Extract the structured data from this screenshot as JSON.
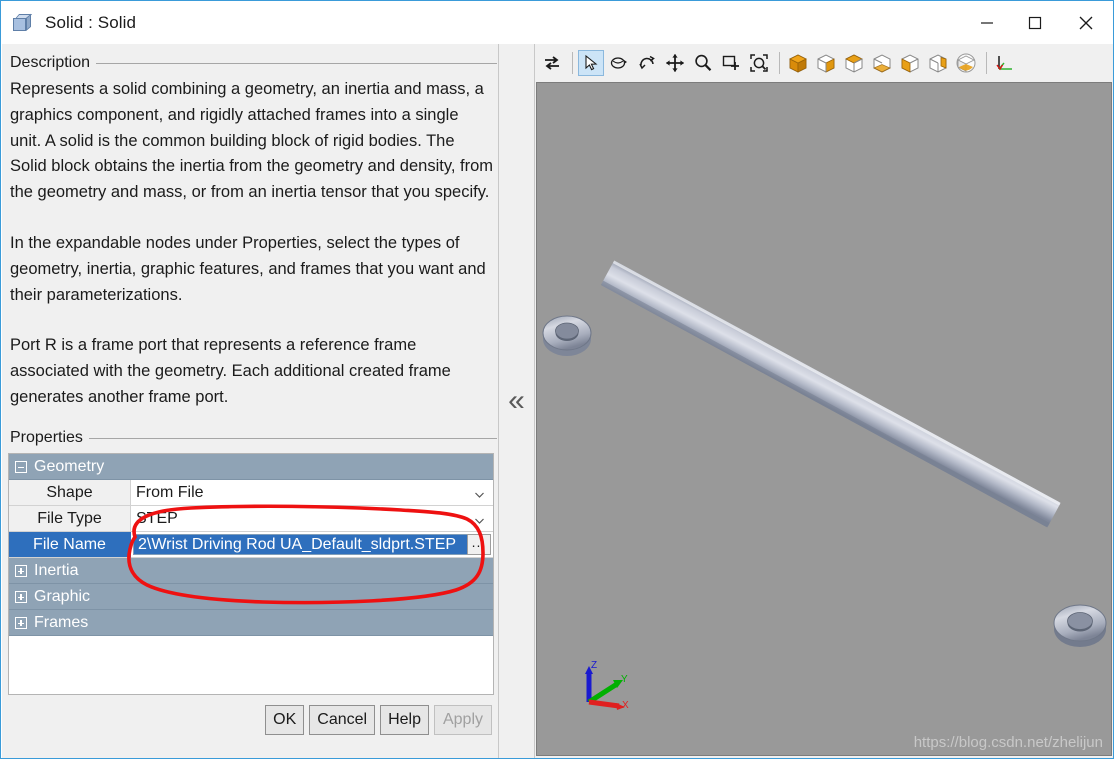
{
  "window": {
    "title": "Solid : Solid",
    "icon": "cube-icon",
    "controls": {
      "minimize": "minimize",
      "maximize": "maximize",
      "close": "close"
    }
  },
  "description": {
    "legend": "Description",
    "paragraphs": [
      "Represents a solid combining a geometry, an inertia and mass, a graphics component, and rigidly attached frames into a single unit. A solid is the common building block of rigid bodies. The Solid block obtains the inertia from the geometry and density, from the geometry and mass, or from an inertia tensor that you specify.",
      "In the expandable nodes under Properties, select the types of geometry, inertia, graphic features, and frames that you want and their parameterizations.",
      "Port R is a frame port that represents a reference frame associated with the geometry. Each additional created frame generates another frame port."
    ]
  },
  "properties": {
    "legend": "Properties",
    "rows": [
      {
        "kind": "group",
        "label": "Geometry",
        "expanded": true
      },
      {
        "kind": "prop",
        "label": "Shape",
        "value": "From File",
        "control": "dropdown",
        "selected": false
      },
      {
        "kind": "prop",
        "label": "File Type",
        "value": "STEP",
        "control": "dropdown",
        "selected": false
      },
      {
        "kind": "prop",
        "label": "File Name",
        "value": "2\\Wrist Driving Rod UA_Default_sldprt.STEP",
        "control": "file",
        "browse_label": "...",
        "selected": true
      },
      {
        "kind": "group",
        "label": "Inertia",
        "expanded": false
      },
      {
        "kind": "group",
        "label": "Graphic",
        "expanded": false
      },
      {
        "kind": "group",
        "label": "Frames",
        "expanded": false
      }
    ]
  },
  "buttons": {
    "ok": "OK",
    "cancel": "Cancel",
    "help": "Help",
    "apply": "Apply",
    "apply_disabled": true
  },
  "splitter": {
    "collapse_glyph": "«",
    "name": "collapse-panel-chevrons"
  },
  "toolbar": {
    "items": [
      {
        "name": "swap-arrows-icon",
        "active": false
      },
      {
        "name": "separator"
      },
      {
        "name": "select-arrow-icon",
        "active": true
      },
      {
        "name": "rotate-view-icon",
        "active": false
      },
      {
        "name": "orbit-icon",
        "active": false
      },
      {
        "name": "pan-icon",
        "active": false
      },
      {
        "name": "zoom-icon",
        "active": false
      },
      {
        "name": "zoom-box-icon",
        "active": false
      },
      {
        "name": "fit-to-view-icon",
        "active": false
      },
      {
        "name": "separator"
      },
      {
        "name": "view-isometric-icon",
        "active": false
      },
      {
        "name": "view-front-icon",
        "active": false
      },
      {
        "name": "view-top-icon",
        "active": false
      },
      {
        "name": "view-bottom-icon",
        "active": false
      },
      {
        "name": "view-left-icon",
        "active": false
      },
      {
        "name": "view-right-icon",
        "active": false
      },
      {
        "name": "view-rotate-cube-icon",
        "active": false
      },
      {
        "name": "separator"
      },
      {
        "name": "axis-triad-icon",
        "active": false
      }
    ]
  },
  "viewport": {
    "background_color": "#999999",
    "model": "wrist-driving-rod",
    "axes": {
      "x": "X",
      "y": "Y",
      "z": "Z",
      "x_color": "#e02020",
      "y_color": "#00b000",
      "z_color": "#1a1ad0"
    },
    "watermark": "https://blog.csdn.net/zhelijun"
  },
  "annotation": {
    "type": "hand-drawn-ellipse",
    "color": "#ee1111"
  }
}
